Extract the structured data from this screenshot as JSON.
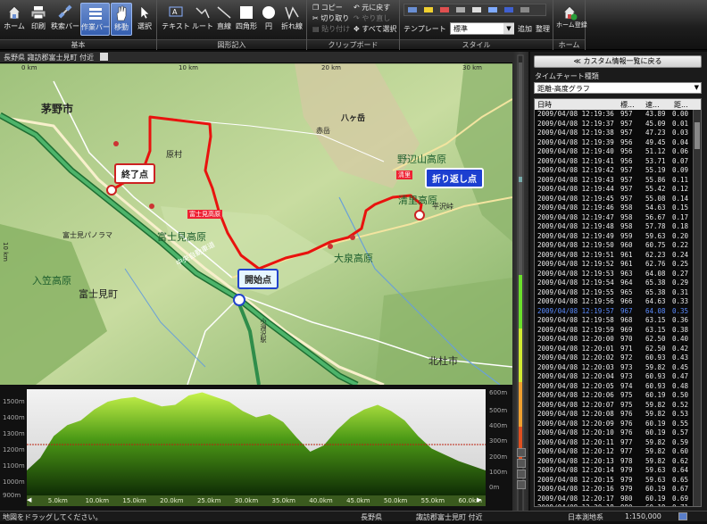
{
  "ribbon": {
    "groups": [
      {
        "label": "基本"
      },
      {
        "label": "図形記入"
      },
      {
        "label": "クリップボード"
      },
      {
        "label": "スタイル"
      },
      {
        "label": "ホーム"
      }
    ],
    "buttons": {
      "home": "ホーム",
      "print": "印刷",
      "gps_bar": "秩索バー",
      "work_bar": "作業バー",
      "move": "移動",
      "select": "選択",
      "text": "テキスト",
      "route": "ルート",
      "line": "直線",
      "rect": "四角形",
      "circle": "円",
      "polyline": "折れ線",
      "home_register": "ホーム登録"
    },
    "clipboard": {
      "copy": "コピー",
      "cut": "切り取り",
      "paste": "貼り付け",
      "undo": "元に戻す",
      "redo": "やり直し",
      "select_all": "すべて選択"
    },
    "style": {
      "template_label": "テンプレート",
      "template_value": "標準",
      "add": "追加",
      "organize": "整理"
    }
  },
  "map": {
    "header": "長野県 諏訪郡富士見町 付近",
    "scale_top": [
      "0 km",
      "10 km",
      "20 km",
      "30 km",
      "40 km"
    ],
    "scale_left": "10 km",
    "labels": {
      "chino": "茅野市",
      "yatsugatake": "八ヶ岳",
      "akadake": "赤岳",
      "nobeyama": "野辺山高原",
      "kiyosato": "清里高原",
      "hirasawa": "平沢峠",
      "fujimi_kogen": "富士見高原",
      "hara": "原村",
      "fujimi_panorama": "富士見パノラマ",
      "fujimi_town": "富士見町",
      "iriyama": "入笠高原",
      "oizumi": "大泉高原",
      "hokuto": "北杜市",
      "kobuchizawa": "小淵沢駅",
      "kiyosato_tag": "清里",
      "fujimi_tag": "富士見高原",
      "highway": "中央自動車道"
    },
    "markers": {
      "end": "終了点",
      "turn": "折り返し点",
      "start": "開始点"
    }
  },
  "profile": {
    "left_ticks": [
      "1500m",
      "1400m",
      "1300m",
      "1200m",
      "1100m",
      "1000m",
      "900m"
    ],
    "right_ticks": [
      "600m",
      "500m",
      "400m",
      "300m",
      "200m",
      "100m",
      "0m"
    ],
    "bottom_ticks": [
      "5.0km",
      "10.0km",
      "15.0km",
      "20.0km",
      "25.0km",
      "30.0km",
      "35.0km",
      "40.0km",
      "45.0km",
      "50.0km",
      "55.0km",
      "60.0km"
    ],
    "elevation": [
      1040,
      1120,
      1260,
      1330,
      1360,
      1430,
      1480,
      1500,
      1510,
      1480,
      1450,
      1460,
      1520,
      1540,
      1510,
      1480,
      1420,
      1380,
      1400,
      1350,
      1250,
      1160,
      1200,
      1300,
      1380,
      1430,
      1460,
      1420,
      1360,
      1260,
      1180,
      1140,
      1100,
      1070,
      1040
    ]
  },
  "panel": {
    "back_button": "≪ カスタム情報一覧に戻る",
    "chart_type_label": "タイムチャート種類",
    "chart_type_value": "距離-高度グラフ",
    "columns": [
      "日時",
      "標...",
      "速...",
      "距..."
    ],
    "rows": [
      [
        "2009/04/08 12:19:36",
        "957",
        "43.89",
        "0.00"
      ],
      [
        "2009/04/08 12:19:37",
        "957",
        "45.09",
        "0.01"
      ],
      [
        "2009/04/08 12:19:38",
        "957",
        "47.23",
        "0.03"
      ],
      [
        "2009/04/08 12:19:39",
        "956",
        "49.45",
        "0.04"
      ],
      [
        "2009/04/08 12:19:40",
        "956",
        "51.12",
        "0.06"
      ],
      [
        "2009/04/08 12:19:41",
        "956",
        "53.71",
        "0.07"
      ],
      [
        "2009/04/08 12:19:42",
        "957",
        "55.19",
        "0.09"
      ],
      [
        "2009/04/08 12:19:43",
        "957",
        "55.86",
        "0.11"
      ],
      [
        "2009/04/08 12:19:44",
        "957",
        "55.42",
        "0.12"
      ],
      [
        "2009/04/08 12:19:45",
        "957",
        "55.08",
        "0.14"
      ],
      [
        "2009/04/08 12:19:46",
        "958",
        "54.63",
        "0.15"
      ],
      [
        "2009/04/08 12:19:47",
        "958",
        "56.67",
        "0.17"
      ],
      [
        "2009/04/08 12:19:48",
        "958",
        "57.78",
        "0.18"
      ],
      [
        "2009/04/08 12:19:49",
        "959",
        "59.63",
        "0.20"
      ],
      [
        "2009/04/08 12:19:50",
        "960",
        "60.75",
        "0.22"
      ],
      [
        "2009/04/08 12:19:51",
        "961",
        "62.23",
        "0.24"
      ],
      [
        "2009/04/08 12:19:52",
        "961",
        "62.76",
        "0.25"
      ],
      [
        "2009/04/08 12:19:53",
        "963",
        "64.08",
        "0.27"
      ],
      [
        "2009/04/08 12:19:54",
        "964",
        "65.38",
        "0.29"
      ],
      [
        "2009/04/08 12:19:55",
        "965",
        "65.38",
        "0.31"
      ],
      [
        "2009/04/08 12:19:56",
        "966",
        "64.63",
        "0.33"
      ],
      [
        "2009/04/08 12:19:57",
        "967",
        "64.08",
        "0.35"
      ],
      [
        "2009/04/08 12:19:58",
        "968",
        "63.15",
        "0.36"
      ],
      [
        "2009/04/08 12:19:59",
        "969",
        "63.15",
        "0.38"
      ],
      [
        "2009/04/08 12:20:00",
        "970",
        "62.50",
        "0.40"
      ],
      [
        "2009/04/08 12:20:01",
        "971",
        "62.50",
        "0.42"
      ],
      [
        "2009/04/08 12:20:02",
        "972",
        "60.93",
        "0.43"
      ],
      [
        "2009/04/08 12:20:03",
        "973",
        "59.82",
        "0.45"
      ],
      [
        "2009/04/08 12:20:04",
        "973",
        "60.93",
        "0.47"
      ],
      [
        "2009/04/08 12:20:05",
        "974",
        "60.93",
        "0.48"
      ],
      [
        "2009/04/08 12:20:06",
        "975",
        "60.19",
        "0.50"
      ],
      [
        "2009/04/08 12:20:07",
        "975",
        "59.82",
        "0.52"
      ],
      [
        "2009/04/08 12:20:08",
        "976",
        "59.82",
        "0.53"
      ],
      [
        "2009/04/08 12:20:09",
        "976",
        "60.19",
        "0.55"
      ],
      [
        "2009/04/08 12:20:10",
        "976",
        "60.19",
        "0.57"
      ],
      [
        "2009/04/08 12:20:11",
        "977",
        "59.82",
        "0.59"
      ],
      [
        "2009/04/08 12:20:12",
        "977",
        "59.82",
        "0.60"
      ],
      [
        "2009/04/08 12:20:13",
        "978",
        "59.82",
        "0.62"
      ],
      [
        "2009/04/08 12:20:14",
        "979",
        "59.63",
        "0.64"
      ],
      [
        "2009/04/08 12:20:15",
        "979",
        "59.63",
        "0.65"
      ],
      [
        "2009/04/08 12:20:16",
        "979",
        "60.19",
        "0.67"
      ],
      [
        "2009/04/08 12:20:17",
        "980",
        "60.19",
        "0.69"
      ],
      [
        "2009/04/08 12:20:18",
        "980",
        "60.19",
        "0.71"
      ]
    ],
    "selected_row": 21
  },
  "status": {
    "hint": "地図をドラッグしてください。",
    "prefecture": "長野県",
    "location": "諏訪郡富士見町 付近",
    "datum": "日本測地系",
    "scale": "1:150,000"
  },
  "colors": {
    "route": "#e8130e",
    "highway": "#2f8d4a",
    "terrain": "#b9d69b",
    "profile_fill": "#3d8a12",
    "selected_row": "#5b8cff"
  }
}
